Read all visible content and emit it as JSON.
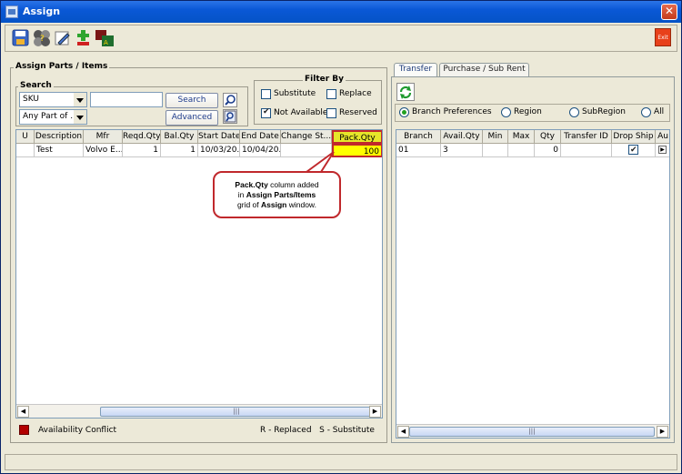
{
  "window": {
    "title": "Assign"
  },
  "toolbar": {
    "icons": [
      "save-icon",
      "options-icon",
      "edit-icon",
      "add-remove-icon",
      "assign-icon"
    ],
    "exit_label": "Exit"
  },
  "assign_parts": {
    "group_label": "Assign Parts / Items",
    "search": {
      "label": "Search",
      "type_value": "SKU",
      "match_value": "Any Part of ...",
      "input_value": "",
      "search_button": "Search",
      "advanced_button": "Advanced"
    },
    "filter": {
      "label": "Filter By",
      "substitute": {
        "label": "Substitute",
        "checked": false
      },
      "replace": {
        "label": "Replace",
        "checked": false
      },
      "not_available": {
        "label": "Not Available",
        "checked": true
      },
      "reserved": {
        "label": "Reserved",
        "checked": false
      }
    },
    "grid": {
      "columns": [
        "U",
        "Description",
        "Mfr",
        "Reqd.Qty",
        "Bal.Qty",
        "Start Date",
        "End Date",
        "Change St...",
        "Pack.Qty"
      ],
      "rows": [
        [
          "",
          "Test",
          "Volvo E...",
          "1",
          "1",
          "10/03/20...",
          "10/04/20...",
          "",
          "100"
        ]
      ]
    },
    "legend": {
      "conflict_label": "Availability Conflict",
      "conflict_color": "#B30000",
      "codes": "R - Replaced   S - Substitute"
    }
  },
  "callout": {
    "part1": "Pack.Qty",
    "part2": " column added",
    "part3": "in ",
    "part4": "Assign Parts/Items",
    "part5": "grid of ",
    "part6": "Assign",
    "part7": " window."
  },
  "right_panel": {
    "tabs": [
      {
        "label": "Transfer",
        "active": true
      },
      {
        "label": "Purchase / Sub Rent",
        "active": false
      }
    ],
    "radios": [
      {
        "label": "Branch Preferences",
        "selected": true
      },
      {
        "label": "Region",
        "selected": false
      },
      {
        "label": "SubRegion",
        "selected": false
      },
      {
        "label": "All",
        "selected": false
      }
    ],
    "grid": {
      "columns": [
        "Branch",
        "Avail.Qty",
        "Min",
        "Max",
        "Qty",
        "Transfer ID",
        "Drop Ship",
        "Au"
      ],
      "rows": [
        {
          "branch": "01",
          "avail_qty": "3",
          "min": "",
          "max": "",
          "qty": "0",
          "transfer_id": "",
          "drop_ship": true
        }
      ]
    }
  },
  "colors": {
    "title_bar": "#0A58D6",
    "highlight_cell": "#FFFF00",
    "callout_border": "#C0282C"
  }
}
